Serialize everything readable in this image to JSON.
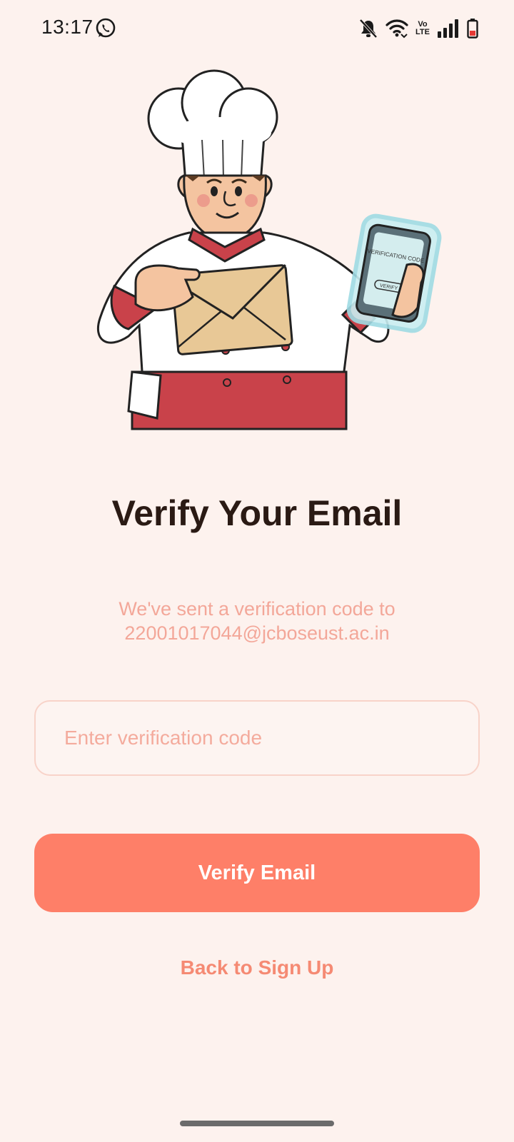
{
  "status_bar": {
    "time": "13:17",
    "left_icon": "whatsapp-icon",
    "right_icons": [
      "bell-off-icon",
      "wifi-icon",
      "volte-icon",
      "signal-icon",
      "battery-low-icon"
    ],
    "volte_text": "Vo LTE"
  },
  "illustration": {
    "name": "chef-with-envelope-and-phone",
    "phone_text": "VERIFICATION CODE",
    "phone_button": "VERIFY"
  },
  "main": {
    "title": "Verify Your Email",
    "subtitle_line1": "We've sent a verification code to",
    "subtitle_line2": "22001017044@jcboseust.ac.in",
    "code_input": {
      "value": "",
      "placeholder": "Enter verification code"
    },
    "verify_button": "Verify Email",
    "back_link": "Back to Sign Up"
  },
  "colors": {
    "background": "#fdf2ee",
    "accent": "#fe7f68",
    "title": "#2a1a14",
    "subtitle": "#f3a799",
    "link": "#f58a73"
  }
}
